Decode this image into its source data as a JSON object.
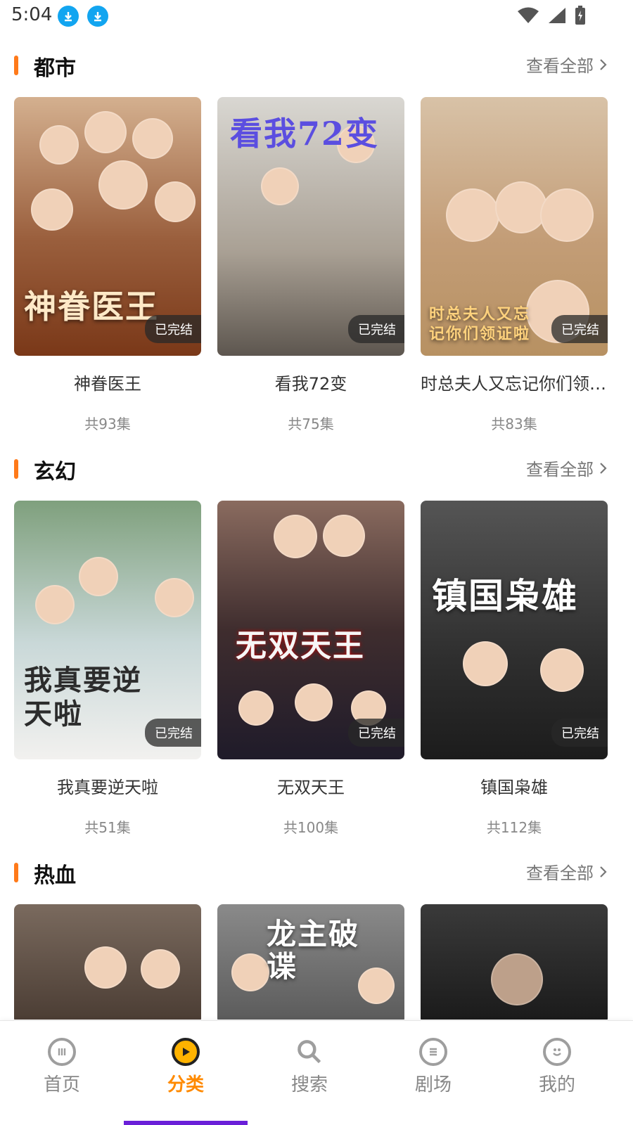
{
  "status_bar": {
    "time": "5:04"
  },
  "sections": [
    {
      "title": "都市",
      "view_all": "查看全部",
      "cards": [
        {
          "title": "神眷医王",
          "episodes": "共93集",
          "badge": "已完结",
          "poster_text": "神眷医王",
          "poster_bg": "#8a4a2a"
        },
        {
          "title": "看我72变",
          "episodes": "共75集",
          "badge": "已完结",
          "poster_text": "看我72变",
          "poster_bg": "#b9b1a8"
        },
        {
          "title": "时总夫人又忘记你们领证啦",
          "episodes": "共83集",
          "badge": "已完结",
          "poster_text": "时总夫人又忘记你们领证啦",
          "poster_bg": "#c19b73"
        }
      ]
    },
    {
      "title": "玄幻",
      "view_all": "查看全部",
      "cards": [
        {
          "title": "我真要逆天啦",
          "episodes": "共51集",
          "badge": "已完结",
          "poster_text": "我真要逆天啦",
          "poster_bg": "#9fb99b"
        },
        {
          "title": "无双天王",
          "episodes": "共100集",
          "badge": "已完结",
          "poster_text": "无双天王",
          "poster_bg": "#5c3b34"
        },
        {
          "title": "镇国枭雄",
          "episodes": "共112集",
          "badge": "已完结",
          "poster_text": "镇国枭雄",
          "poster_bg": "#3b3b3b"
        }
      ]
    },
    {
      "title": "热血",
      "view_all": "查看全部",
      "cards": [
        {
          "title": "",
          "episodes": "",
          "badge": "",
          "poster_text": "",
          "poster_bg": "#5a4a3f"
        },
        {
          "title": "",
          "episodes": "",
          "badge": "",
          "poster_text": "龙主破谍",
          "poster_bg": "#707070"
        },
        {
          "title": "",
          "episodes": "",
          "badge": "",
          "poster_text": "",
          "poster_bg": "#2f2f2f"
        }
      ]
    }
  ],
  "tabbar": {
    "items": [
      {
        "label": "首页",
        "icon": "home-icon"
      },
      {
        "label": "分类",
        "icon": "category-icon"
      },
      {
        "label": "搜索",
        "icon": "search-icon"
      },
      {
        "label": "剧场",
        "icon": "theater-icon"
      },
      {
        "label": "我的",
        "icon": "profile-icon"
      }
    ],
    "active_index": 1
  },
  "colors": {
    "accent": "#ff7a1a",
    "active_tab": "#ff8a00",
    "underline": "#6a1fd8"
  }
}
